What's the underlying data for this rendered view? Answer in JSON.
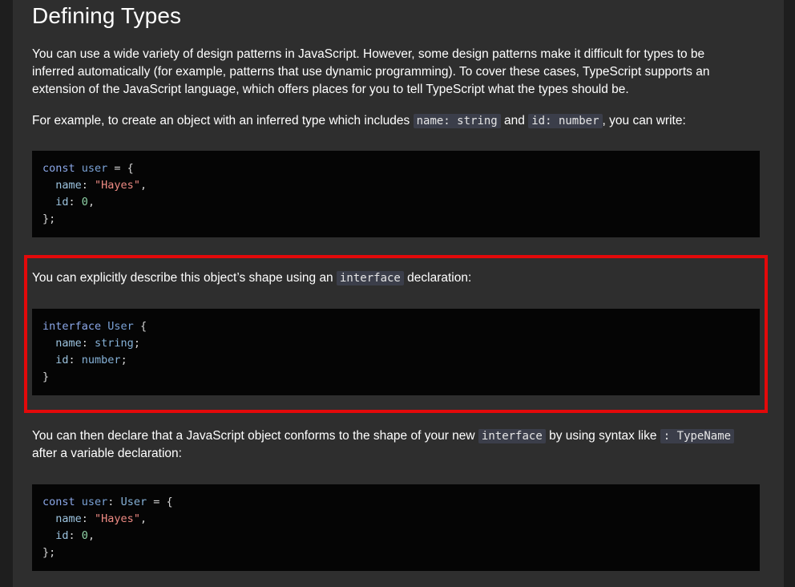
{
  "heading": "Defining Types",
  "intro": {
    "p1": "You can use a wide variety of design patterns in JavaScript. However, some design patterns make it difficult for types to be inferred automatically (for example, patterns that use dynamic programming). To cover these cases, TypeScript supports an extension of the JavaScript language, which offers places for you to tell TypeScript what the types should be.",
    "p2_before": "For example, to create an object with an inferred type which includes ",
    "p2_code1": "name: string",
    "p2_mid": " and ",
    "p2_code2": "id: number",
    "p2_after": ", you can write:"
  },
  "code1": {
    "l1_kw": "const",
    "l1_id": "user",
    "l1_rest": " = {",
    "l2_prop": "name",
    "l2_str": "\"Hayes\"",
    "l3_prop": "id",
    "l3_num": "0",
    "l4": "};"
  },
  "explicit": {
    "before": "You can explicitly describe this object’s shape using an ",
    "code": "interface",
    "after": " declaration:"
  },
  "code2": {
    "l1_kw": "interface",
    "l1_id": "User",
    "l1_rest": " {",
    "l2_prop": "name",
    "l2_type": "string",
    "l3_prop": "id",
    "l3_type": "number",
    "l4": "}"
  },
  "declare": {
    "before": "You can then declare that a JavaScript object conforms to the shape of your new ",
    "code1": "interface",
    "mid": " by using syntax like ",
    "code2": ": TypeName",
    "after": " after a variable declaration:"
  },
  "code3": {
    "l1_kw": "const",
    "l1_id": "user",
    "l1_type": "User",
    "l1_rest": " = {",
    "l2_prop": "name",
    "l2_str": "\"Hayes\"",
    "l3_prop": "id",
    "l3_num": "0",
    "l4": "};"
  },
  "colors": {
    "highlight_border": "#e3090a",
    "page_bg": "#2e2e2e",
    "code_bg": "#050505"
  }
}
